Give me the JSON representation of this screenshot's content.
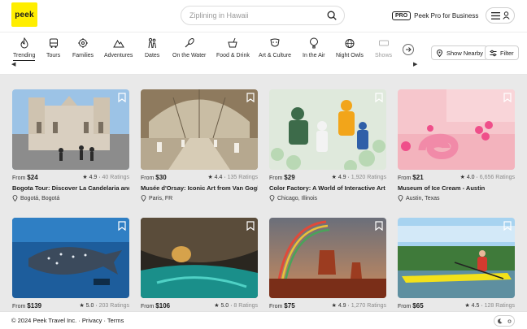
{
  "header": {
    "logo": "peek",
    "search_placeholder": "Ziplining in Hawaii",
    "pro_badge": "PRO",
    "pro_link": "Peek Pro for Business"
  },
  "categories": [
    {
      "label": "Trending",
      "icon": "fire-icon"
    },
    {
      "label": "Tours",
      "icon": "bus-icon"
    },
    {
      "label": "Families",
      "icon": "family-icon"
    },
    {
      "label": "Adventures",
      "icon": "mountain-icon"
    },
    {
      "label": "Dates",
      "icon": "couple-icon"
    },
    {
      "label": "On the Water",
      "icon": "paddle-icon"
    },
    {
      "label": "Food & Drink",
      "icon": "drink-icon"
    },
    {
      "label": "Art & Culture",
      "icon": "mask-icon"
    },
    {
      "label": "In the Air",
      "icon": "balloon-icon"
    },
    {
      "label": "Night Owls",
      "icon": "disco-ball-icon"
    },
    {
      "label": "Shows",
      "icon": "ticket-icon"
    }
  ],
  "filters": {
    "nearby": "Show Nearby",
    "filter": "Filter"
  },
  "listings": [
    {
      "price_prefix": "From",
      "price": "$24",
      "rating": "4.9",
      "ratings_count": "40 Ratings",
      "title": "Bogota Tour: Discover La Candelaria and Mon",
      "location": "Bogotá, Bogotá"
    },
    {
      "price_prefix": "From",
      "price": "$30",
      "rating": "4.4",
      "ratings_count": "135 Ratings",
      "title": "Musée d'Orsay: Iconic Art from Van Gogh to M",
      "location": "Paris, FR"
    },
    {
      "price_prefix": "From",
      "price": "$29",
      "rating": "4.9",
      "ratings_count": "1,920 Ratings",
      "title": "Color Factory: A World of Interactive Art",
      "location": "Chicago, Illinois"
    },
    {
      "price_prefix": "From",
      "price": "$21",
      "rating": "4.0",
      "ratings_count": "6,656 Ratings",
      "title": "Museum of Ice Cream - Austin",
      "location": "Austin, Texas"
    },
    {
      "price_prefix": "From",
      "price": "$139",
      "rating": "5.0",
      "ratings_count": "203 Ratings",
      "title": "",
      "location": ""
    },
    {
      "price_prefix": "From",
      "price": "$106",
      "rating": "5.0",
      "ratings_count": "8 Ratings",
      "title": "",
      "location": ""
    },
    {
      "price_prefix": "From",
      "price": "$75",
      "rating": "4.9",
      "ratings_count": "1,270 Ratings",
      "title": "",
      "location": ""
    },
    {
      "price_prefix": "From",
      "price": "$65",
      "rating": "4.5",
      "ratings_count": "128 Ratings",
      "title": "",
      "location": ""
    }
  ],
  "footer": {
    "text": "© 2024 Peek Travel Inc. · Privacy · Terms"
  },
  "colors": {
    "brand": "#ffee00",
    "text": "#1b1b1b",
    "background": "#e9e9e9"
  }
}
